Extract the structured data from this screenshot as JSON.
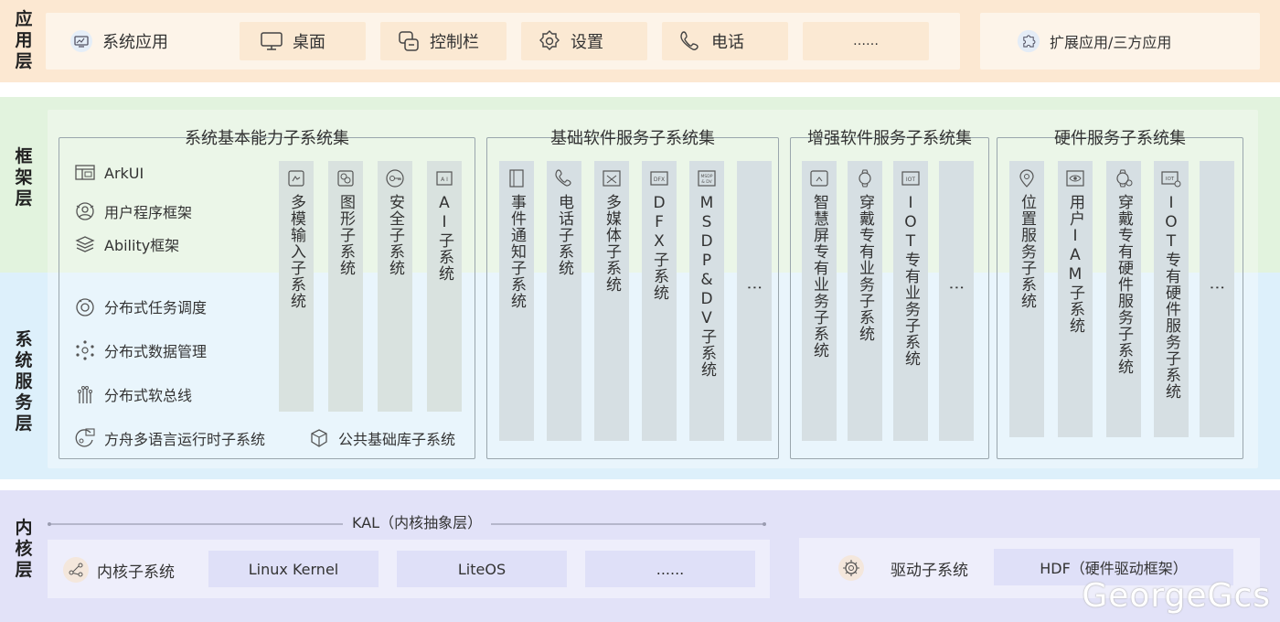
{
  "layers": {
    "app": "应用层",
    "framework": "框架层",
    "system_services": "系统服务层",
    "kernel": "内核层"
  },
  "app_layer": {
    "items": [
      {
        "label": "系统应用",
        "icon": "system-app-icon"
      },
      {
        "label": "桌面",
        "icon": "monitor-icon"
      },
      {
        "label": "控制栏",
        "icon": "control-bar-icon"
      },
      {
        "label": "设置",
        "icon": "gear-icon"
      },
      {
        "label": "电话",
        "icon": "phone-icon"
      },
      {
        "label": "……"
      }
    ],
    "extension": {
      "label": "扩展应用/三方应用",
      "icon": "puzzle-icon"
    }
  },
  "groups": {
    "basic": {
      "title": "系统基本能力子系统集",
      "framework_items": [
        {
          "label": "ArkUI",
          "icon": "arkui-icon"
        },
        {
          "label": "用户程序框架",
          "icon": "user-framework-icon"
        },
        {
          "label": "Ability框架",
          "icon": "layers-icon"
        }
      ],
      "service_items": [
        {
          "label": "分布式任务调度",
          "icon": "task-schedule-icon"
        },
        {
          "label": "分布式数据管理",
          "icon": "data-manage-icon"
        },
        {
          "label": "分布式软总线",
          "icon": "soft-bus-icon"
        }
      ],
      "bottom_items": [
        {
          "label": "方舟多语言运行时子系统",
          "icon": "runtime-icon"
        },
        {
          "label": "公共基础库子系统",
          "icon": "cube-icon"
        }
      ],
      "columns": [
        {
          "label": "多模输入子系统",
          "icon": "multimodal-icon"
        },
        {
          "label": "图形子系统",
          "icon": "graphics-icon"
        },
        {
          "label": "安全子系统",
          "icon": "key-icon"
        },
        {
          "label": "AI子系统",
          "icon": "ai-icon"
        }
      ]
    },
    "base_software": {
      "title": "基础软件服务子系统集",
      "columns": [
        {
          "label": "事件通知子系统",
          "icon": "notification-icon"
        },
        {
          "label": "电话子系统",
          "icon": "telephony-icon"
        },
        {
          "label": "多媒体子系统",
          "icon": "media-icon"
        },
        {
          "label": "DFX子系统",
          "icon": "dfx-icon"
        },
        {
          "label": "MSDP&DV子系统",
          "icon": "msdp-icon"
        },
        {
          "label": "⋮"
        }
      ]
    },
    "enhanced_software": {
      "title": "增强软件服务子系统集",
      "columns": [
        {
          "label": "智慧屏专有业务子系统",
          "icon": "smart-screen-icon"
        },
        {
          "label": "穿戴专有业务子系统",
          "icon": "watch-icon"
        },
        {
          "label": "IOT专有业务子系统",
          "icon": "iot-icon"
        },
        {
          "label": "⋮"
        }
      ]
    },
    "hardware": {
      "title": "硬件服务子系统集",
      "columns": [
        {
          "label": "位置服务子系统",
          "icon": "location-icon"
        },
        {
          "label": "用户IAM子系统",
          "icon": "eye-icon"
        },
        {
          "label": "穿戴专有硬件服务子系统",
          "icon": "watch-gear-icon"
        },
        {
          "label": "IOT专有硬件服务子系统",
          "icon": "iot-gear-icon"
        },
        {
          "label": "⋮"
        }
      ]
    }
  },
  "kernel_layer": {
    "kal": "KAL（内核抽象层）",
    "kernel_subsystem": {
      "label": "内核子系统",
      "icon": "kernel-icon"
    },
    "kernels": [
      "Linux Kernel",
      "LiteOS",
      "......"
    ],
    "driver_subsystem": {
      "label": "驱动子系统",
      "icon": "driver-icon"
    },
    "hdf": "HDF（硬件驱动框架）"
  },
  "watermark": "GeorgeGcs",
  "colors": {
    "app_band": "#fce8d2",
    "framework_band": "#e2f3de",
    "service_band": "#ddf0fb",
    "kernel_band": "#e2e2f8"
  }
}
